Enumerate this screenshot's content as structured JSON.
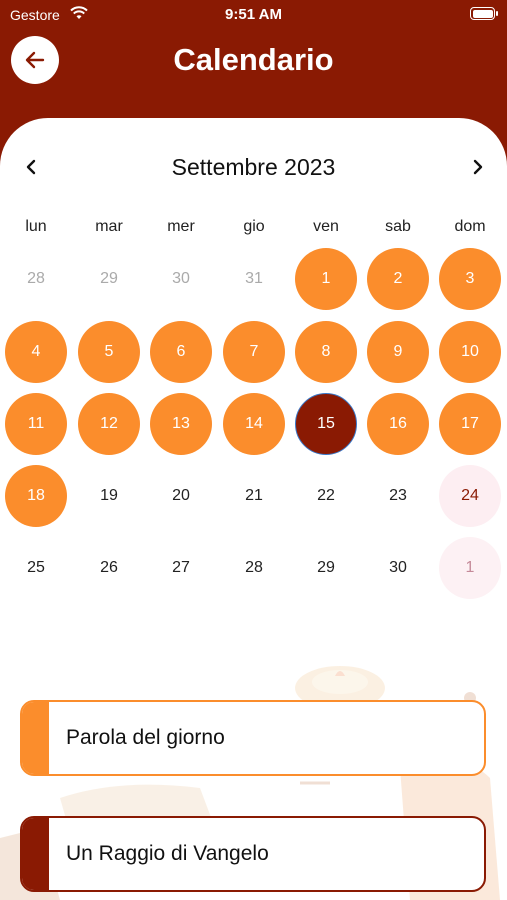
{
  "status_bar": {
    "carrier": "Gestore",
    "time": "9:51 AM"
  },
  "header": {
    "title": "Calendario"
  },
  "calendar": {
    "month_label": "Settembre 2023",
    "weekdays": [
      "lun",
      "mar",
      "mer",
      "gio",
      "ven",
      "sab",
      "dom"
    ],
    "weeks": [
      [
        {
          "label": "28",
          "state": "muted"
        },
        {
          "label": "29",
          "state": "muted"
        },
        {
          "label": "30",
          "state": "muted"
        },
        {
          "label": "31",
          "state": "muted"
        },
        {
          "label": "1",
          "state": "event"
        },
        {
          "label": "2",
          "state": "event"
        },
        {
          "label": "3",
          "state": "event"
        }
      ],
      [
        {
          "label": "4",
          "state": "event"
        },
        {
          "label": "5",
          "state": "event"
        },
        {
          "label": "6",
          "state": "event"
        },
        {
          "label": "7",
          "state": "event"
        },
        {
          "label": "8",
          "state": "event"
        },
        {
          "label": "9",
          "state": "event"
        },
        {
          "label": "10",
          "state": "event"
        }
      ],
      [
        {
          "label": "11",
          "state": "event"
        },
        {
          "label": "12",
          "state": "event"
        },
        {
          "label": "13",
          "state": "event"
        },
        {
          "label": "14",
          "state": "event"
        },
        {
          "label": "15",
          "state": "selected"
        },
        {
          "label": "16",
          "state": "event"
        },
        {
          "label": "17",
          "state": "event"
        }
      ],
      [
        {
          "label": "18",
          "state": "event"
        },
        {
          "label": "19",
          "state": "plain"
        },
        {
          "label": "20",
          "state": "plain"
        },
        {
          "label": "21",
          "state": "plain"
        },
        {
          "label": "22",
          "state": "plain"
        },
        {
          "label": "23",
          "state": "plain"
        },
        {
          "label": "24",
          "state": "sunday"
        }
      ],
      [
        {
          "label": "25",
          "state": "plain"
        },
        {
          "label": "26",
          "state": "plain"
        },
        {
          "label": "27",
          "state": "plain"
        },
        {
          "label": "28",
          "state": "plain"
        },
        {
          "label": "29",
          "state": "plain"
        },
        {
          "label": "30",
          "state": "plain"
        },
        {
          "label": "1",
          "state": "sunday-next"
        }
      ]
    ]
  },
  "cards": [
    {
      "label": "Parola del giorno"
    },
    {
      "label": "Un Raggio di Vangelo"
    }
  ],
  "colors": {
    "brand": "#8a1a03",
    "accent": "#fb8d2c",
    "sunday_highlight": "#fdeef2"
  },
  "icons": {
    "back": "arrow-left-icon",
    "prev": "chevron-left-icon",
    "next": "chevron-right-icon",
    "wifi": "wifi-icon",
    "battery": "battery-icon"
  }
}
